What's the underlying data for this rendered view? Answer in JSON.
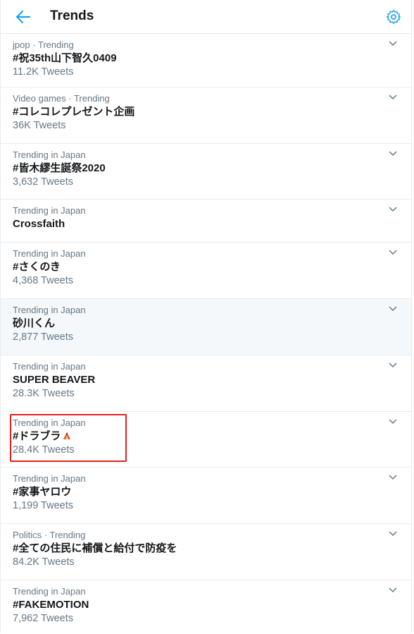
{
  "header": {
    "title": "Trends"
  },
  "colors": {
    "accent": "#1da1f2",
    "highlight_box": "#e0201d"
  },
  "trends": [
    {
      "meta": "jpop · Trending",
      "name": "#祝35th山下智久0409",
      "count": "11.2K Tweets"
    },
    {
      "meta": "Video games · Trending",
      "name": "#コレコレプレゼント企画",
      "count": "36K Tweets"
    },
    {
      "meta": "Trending in Japan",
      "name": "#皆木繆生誕祭2020",
      "count": "3,632 Tweets"
    },
    {
      "meta": "Trending in Japan",
      "name": "Crossfaith",
      "count": ""
    },
    {
      "meta": "Trending in Japan",
      "name": "#さくのき",
      "count": "4,368 Tweets"
    },
    {
      "meta": "Trending in Japan",
      "name": "砂川くん",
      "count": "2,877 Tweets"
    },
    {
      "meta": "Trending in Japan",
      "name": "SUPER BEAVER",
      "count": "28.3K Tweets"
    },
    {
      "meta": "Trending in Japan",
      "name": "#ドラブラ",
      "count": "28.4K Tweets"
    },
    {
      "meta": "Trending in Japan",
      "name": "#家事ヤロウ",
      "count": "1,199 Tweets"
    },
    {
      "meta": "Politics · Trending",
      "name": "#全ての住民に補償と給付で防疫を",
      "count": "84.2K Tweets"
    },
    {
      "meta": "Trending in Japan",
      "name": "#FAKEMOTION",
      "count": "7,962 Tweets"
    }
  ]
}
